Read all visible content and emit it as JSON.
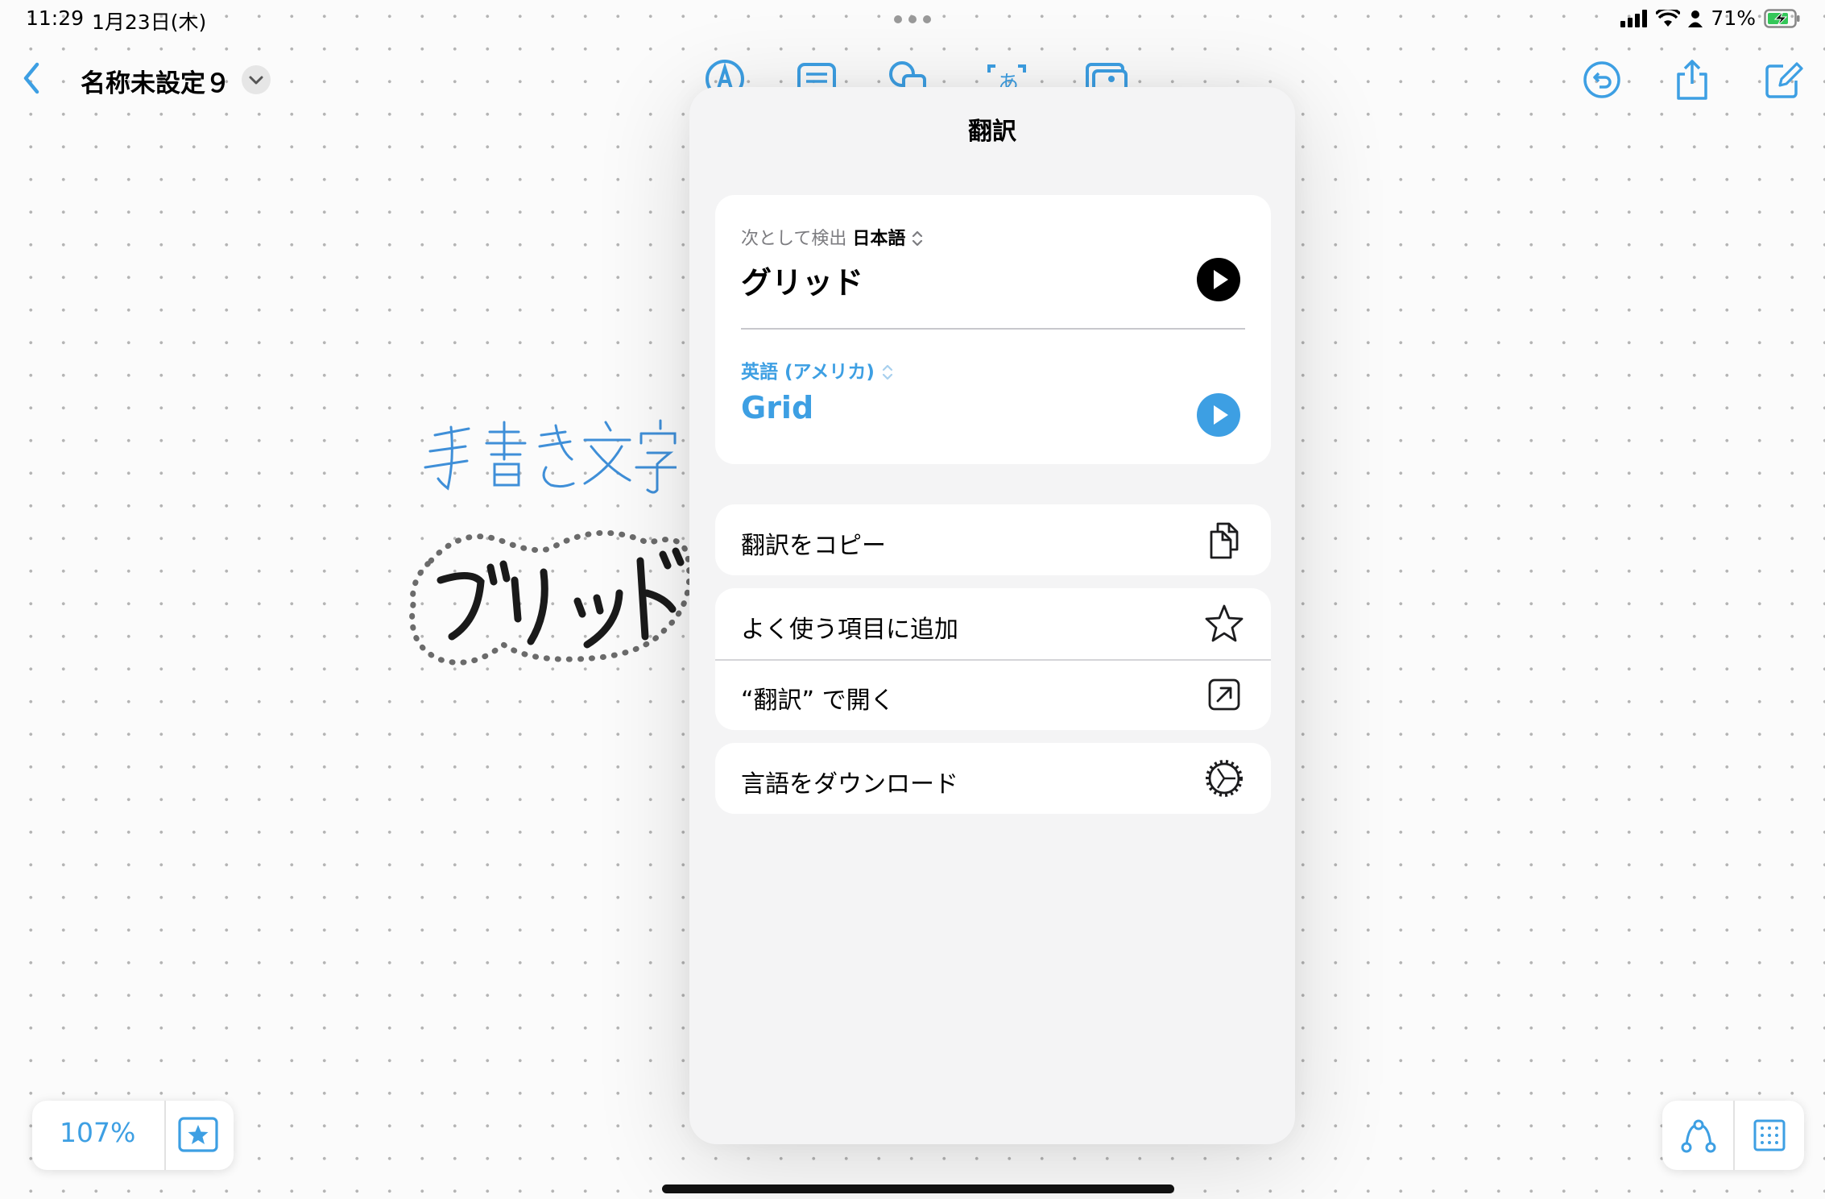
{
  "status": {
    "time": "11:29",
    "date": "1月23日(木)",
    "battery": "71%"
  },
  "header": {
    "title": "名称未設定９"
  },
  "icons": {
    "back": "chevron-left-icon",
    "title_menu": "chevron-down-icon",
    "toolbar": [
      "markup-pen-icon",
      "text-box-icon",
      "shapes-icon",
      "text-recognition-icon",
      "media-icon"
    ],
    "right": [
      "undo-icon",
      "share-icon",
      "compose-icon"
    ],
    "bottom": [
      "favorites-star-icon",
      "connector-icon",
      "grid-icon"
    ]
  },
  "canvas": {
    "handwriting_top": "手書き文字",
    "handwriting_selected": "グリッド"
  },
  "translate": {
    "title": "翻訳",
    "detected_prefix": "次として検出",
    "detected_language": "日本語",
    "source_text": "グリッド",
    "target_language": "英語 (アメリカ)",
    "target_text": "Grid"
  },
  "actions": {
    "copy": "翻訳をコピー",
    "favorite": "よく使う項目に追加",
    "open_in": "“翻訳” で開く",
    "download": "言語をダウンロード"
  },
  "zoom": "107%",
  "colors": {
    "accent": "#3d9fe3",
    "panel": "#f4f4f5",
    "card": "#ffffff"
  }
}
